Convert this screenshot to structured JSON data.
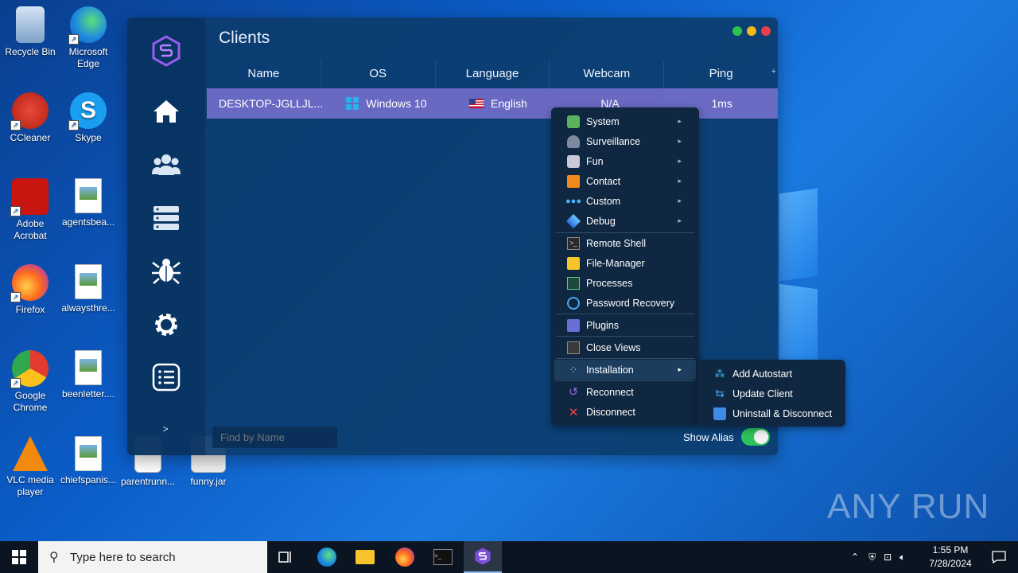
{
  "desktop": {
    "icons": [
      {
        "label": "Recycle Bin"
      },
      {
        "label": "Microsoft Edge"
      },
      {
        "label": "CCleaner"
      },
      {
        "label": "Skype"
      },
      {
        "label": "Adobe Acrobat"
      },
      {
        "label": "agentsbea..."
      },
      {
        "label": "Firefox"
      },
      {
        "label": "alwaysthre..."
      },
      {
        "label": "Google Chrome"
      },
      {
        "label": "beenletter...."
      },
      {
        "label": "VLC media player"
      },
      {
        "label": "chiefspanis..."
      },
      {
        "label": "parentrunn..."
      },
      {
        "label": "funny.jar"
      }
    ]
  },
  "app": {
    "title": "Clients",
    "columns": [
      "Name",
      "OS",
      "Language",
      "Webcam",
      "Ping"
    ],
    "row": {
      "name": "DESKTOP-JGLLJL...",
      "os": "Windows 10",
      "language": "English",
      "webcam": "N/A",
      "ping": "1ms"
    },
    "search_placeholder": "Find by Name",
    "show_alias_label": "Show Alias",
    "expand_label": ">",
    "add_column": "+"
  },
  "context_menu": {
    "items": [
      {
        "label": "System",
        "icon": "chip-icon",
        "has_submenu": true
      },
      {
        "label": "Surveillance",
        "icon": "spy-icon",
        "has_submenu": true
      },
      {
        "label": "Fun",
        "icon": "fun-icon",
        "has_submenu": true
      },
      {
        "label": "Contact",
        "icon": "contact-icon",
        "has_submenu": true
      },
      {
        "label": "Custom",
        "icon": "dots-icon",
        "has_submenu": true
      },
      {
        "label": "Debug",
        "icon": "layers-icon",
        "has_submenu": true
      },
      {
        "label": "Remote Shell",
        "icon": "terminal-icon"
      },
      {
        "label": "File-Manager",
        "icon": "folder-icon"
      },
      {
        "label": "Processes",
        "icon": "monitor-icon"
      },
      {
        "label": "Password Recovery",
        "icon": "eye-icon"
      },
      {
        "label": "Plugins",
        "icon": "plugin-icon"
      },
      {
        "label": "Close Views",
        "icon": "window-icon"
      },
      {
        "label": "Installation",
        "icon": "install-icon",
        "has_submenu": true
      },
      {
        "label": "Reconnect",
        "icon": "reconnect-icon"
      },
      {
        "label": "Disconnect",
        "icon": "x-icon"
      }
    ],
    "submenu": [
      {
        "label": "Add Autostart",
        "icon": "autostart-icon"
      },
      {
        "label": "Update Client",
        "icon": "update-icon"
      },
      {
        "label": "Uninstall & Disconnect",
        "icon": "trash-icon"
      }
    ]
  },
  "watermark": "ANY RUN",
  "taskbar": {
    "search_placeholder": "Type here to search",
    "time": "1:55 PM",
    "date": "7/28/2024"
  },
  "colors": {
    "accent": "#8878dc",
    "toggle_on": "#2ec35a",
    "close": "#e8404a",
    "minimize": "#f5b816",
    "maximize": "#2cc34c"
  }
}
